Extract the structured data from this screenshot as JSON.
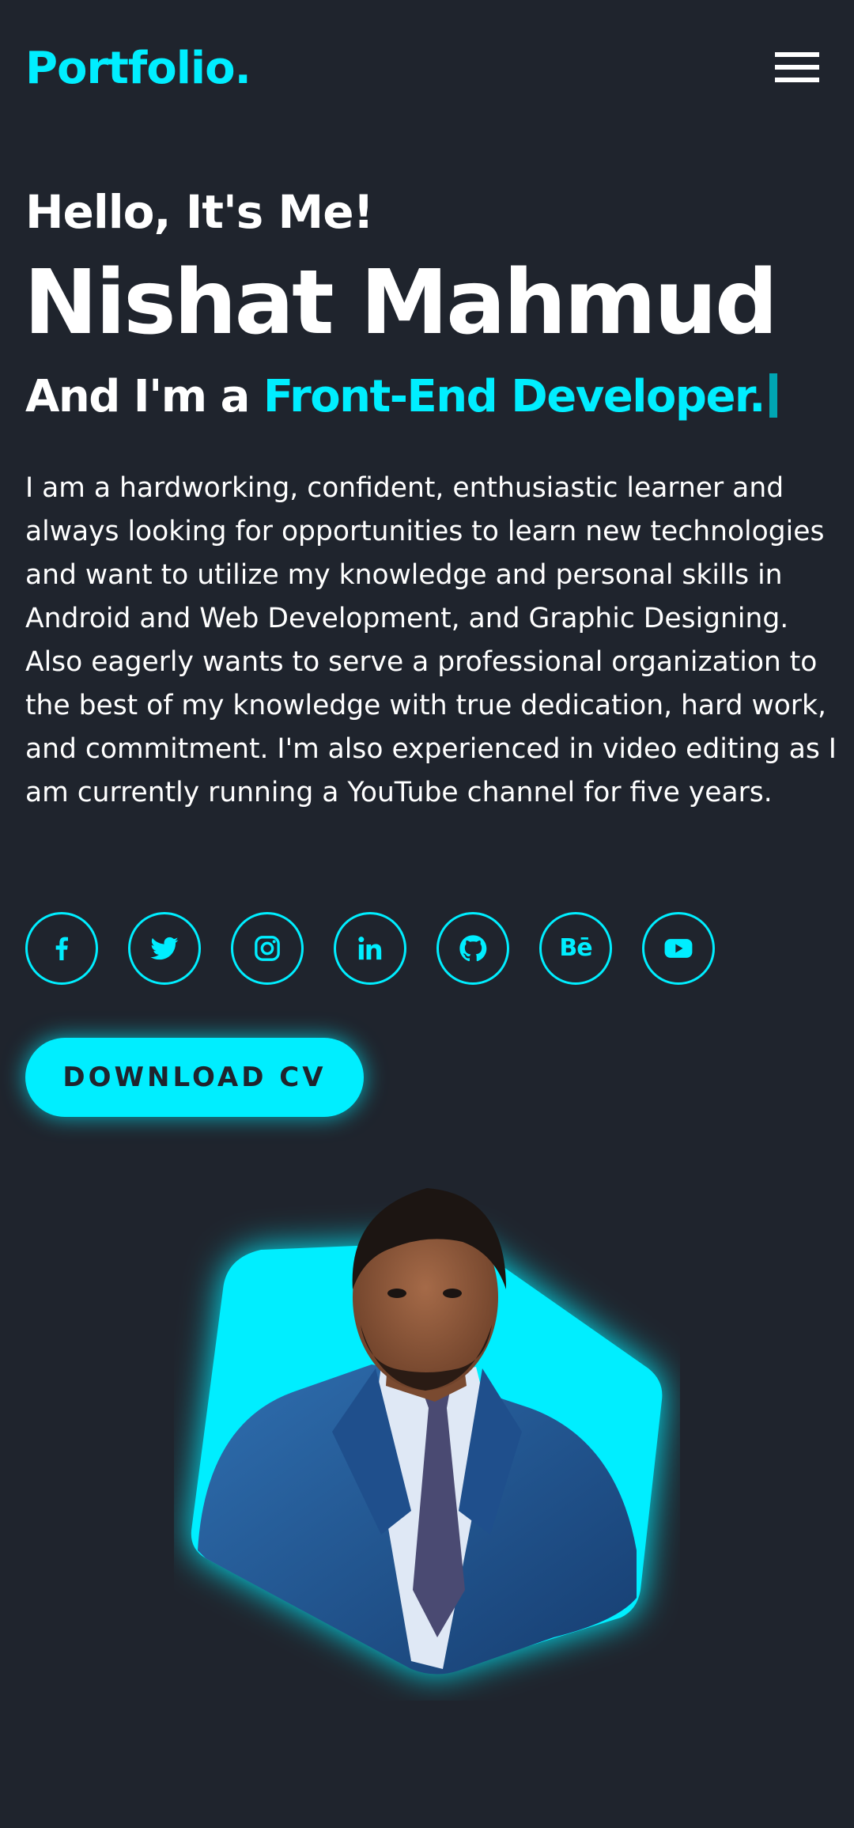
{
  "header": {
    "logo": "Portfolio.",
    "menu_icon": "hamburger-menu-icon"
  },
  "hero": {
    "greeting": "Hello, It's Me!",
    "name": "Nishat Mahmud",
    "role_prefix": "And I'm a ",
    "role": "Front-End Developer.",
    "bio": "I am a hardworking, confident, enthusiastic learner and always looking for opportunities to learn new technologies and want to utilize my knowledge and personal skills in Android and Web Development, and Graphic Designing. Also eagerly wants to serve a professional organization to the best of my knowledge with true dedication, hard work, and commitment. I'm also experienced in video editing as I am currently running a YouTube channel for five years."
  },
  "socials": [
    {
      "icon": "facebook-icon"
    },
    {
      "icon": "twitter-icon"
    },
    {
      "icon": "instagram-icon"
    },
    {
      "icon": "linkedin-icon"
    },
    {
      "icon": "github-icon"
    },
    {
      "icon": "behance-icon",
      "label": "Bē"
    },
    {
      "icon": "youtube-icon"
    }
  ],
  "cta": {
    "download_label": "DOWNLOAD CV"
  },
  "colors": {
    "background": "#1f242d",
    "accent": "#00eeff",
    "text": "#ffffff"
  }
}
